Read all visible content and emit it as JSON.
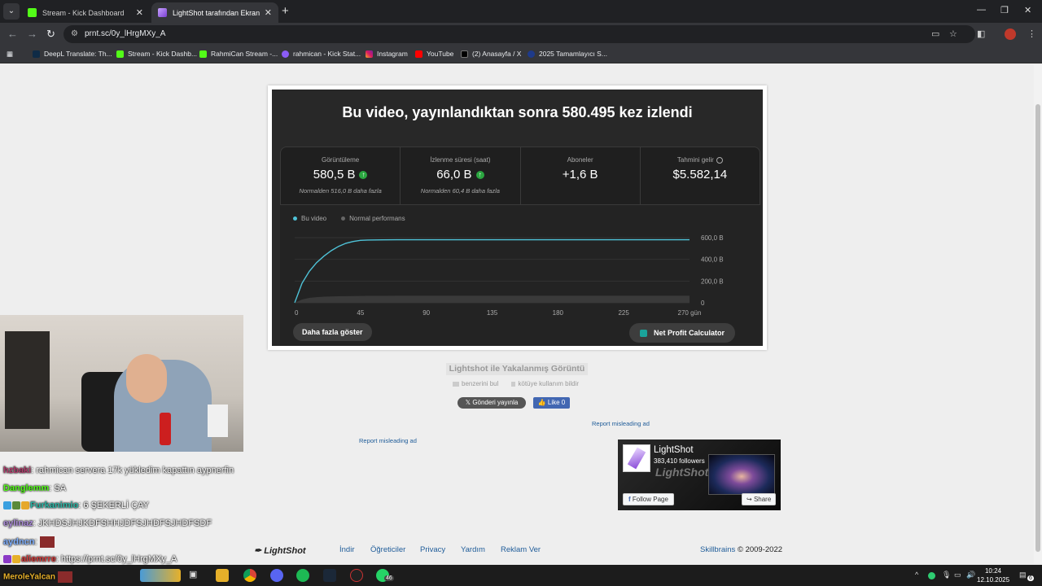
{
  "browser": {
    "tabs": [
      {
        "label": "Stream - Kick Dashboard"
      },
      {
        "label": "LightShot tarafından Ekran Görü"
      }
    ],
    "url": "prnt.sc/0y_lHrgMXy_A",
    "bookmarks": [
      {
        "label": "DeepL Translate: Th..."
      },
      {
        "label": "Stream - Kick Dashb..."
      },
      {
        "label": "RahmiCan Stream -..."
      },
      {
        "label": "rahmican - Kick Stat..."
      },
      {
        "label": "Instagram"
      },
      {
        "label": "YouTube"
      },
      {
        "label": "(2) Anasayfa / X"
      },
      {
        "label": "2025 Tamamlayıcı S..."
      }
    ]
  },
  "screenshot": {
    "headline": "Bu video, yayınlandıktan sonra 580.495 kez izlendi",
    "stats": [
      {
        "label": "Görüntüleme",
        "value": "580,5 B",
        "sub": "Normalden 516,0 B daha fazla"
      },
      {
        "label": "İzlenme süresi (saat)",
        "value": "66,0 B",
        "sub": "Normalden 60,4 B daha fazla"
      },
      {
        "label": "Aboneler",
        "value": "+1,6 B",
        "sub": ""
      },
      {
        "label": "Tahmini gelir",
        "value": "$5.582,14",
        "sub": ""
      }
    ],
    "legend": [
      "Bu video",
      "Normal performans"
    ],
    "more_button": "Daha fazla göster",
    "npc_button": "Net Profit Calculator"
  },
  "chart_data": {
    "type": "line",
    "x": [
      0,
      5,
      10,
      15,
      20,
      25,
      30,
      35,
      40,
      45,
      50,
      60,
      70,
      90,
      135,
      180,
      225,
      270
    ],
    "series": [
      {
        "name": "Bu video",
        "values": [
          0,
          180,
          290,
          370,
          430,
          480,
          520,
          548,
          565,
          575,
          578,
          580,
          580.5,
          580.5,
          580.5,
          580.5,
          580.5,
          580.5
        ]
      },
      {
        "name": "Normal performans",
        "values": [
          0,
          30,
          45,
          52,
          56,
          58,
          60,
          61,
          62,
          63,
          63.5,
          64,
          64.5,
          64.5,
          64.5,
          64.5,
          64.5,
          64.5
        ]
      }
    ],
    "xticks": [
      "0",
      "45",
      "90",
      "135",
      "180",
      "225",
      "270 gün"
    ],
    "yticks": [
      "0",
      "200,0 B",
      "400,0 B",
      "600,0 B"
    ],
    "xlim": [
      0,
      270
    ],
    "ylim": [
      0,
      600
    ],
    "legend_placement": "top-left",
    "colors": {
      "Bu video": "#4fc3d8",
      "Normal performans": "#555555"
    }
  },
  "lightshot": {
    "title": "Lightshot ile Yakalanmış Görüntü",
    "similar": "benzerini bul",
    "report_abuse": "kötüye kullanım bildir",
    "x_share": "Gönderi yayınla",
    "fb_like": "Like 0",
    "report_ad_1": "Report misleading ad",
    "report_ad_2": "Report misleading ad",
    "fb_page": {
      "name": "LightShot",
      "followers": "383,410 followers",
      "watermark": "LightShot",
      "follow": "Follow Page",
      "share": "Share"
    }
  },
  "footer": {
    "brand": "LightShot",
    "links": [
      "İndir",
      "Öğreticiler",
      "Privacy",
      "Yardım",
      "Reklam Ver"
    ],
    "company": "Skillbrains",
    "copyright": "© 2009-2022"
  },
  "chat": [
    {
      "user": "hzbaki",
      "color": "#b03a6a",
      "msg": ": rahmican servera 17k yükledim kapattın aypnerfin"
    },
    {
      "user": "Danglemm",
      "color": "#53fc18",
      "msg": ": SA"
    },
    {
      "user": "Furkanimio",
      "color": "#2ab5a5",
      "msg": ": 6 ŞEKERLİ ÇAY"
    },
    {
      "user": "eylinaz",
      "color": "#a98ad6",
      "msg": ": JKHDSJHJKDFSHHJDFSJHDFSJHDFSDF"
    },
    {
      "user": "aydncn",
      "color": "#7fb0ff",
      "msg": ":"
    },
    {
      "user": "aliemrre",
      "color": "#d43a3a",
      "msg": ": https://prnt.sc/0y_lHrgMXy_A"
    },
    {
      "user": "MeroleYalcan",
      "color": "#e6b02a",
      "msg": ""
    }
  ],
  "taskbar": {
    "time": "10:24",
    "date": "12.10.2025",
    "whatsapp_badge": "46",
    "notif_badge": "6"
  }
}
